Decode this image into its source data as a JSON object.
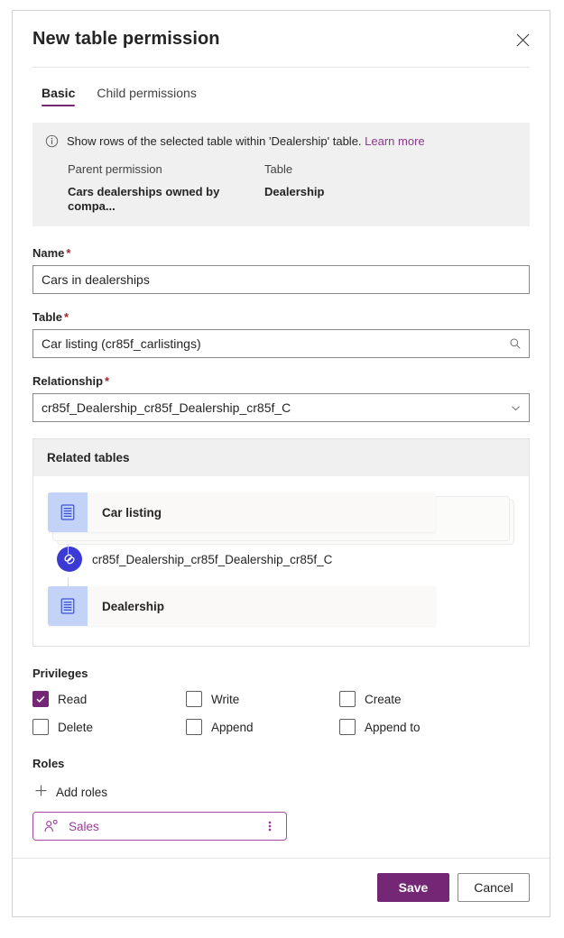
{
  "dialog": {
    "title": "New table permission",
    "close_icon": "close-icon"
  },
  "tabs": [
    {
      "label": "Basic",
      "active": true
    },
    {
      "label": "Child permissions",
      "active": false
    }
  ],
  "info_banner": {
    "icon": "info-icon",
    "message": "Show rows of the selected table within 'Dealership' table.",
    "learn_more": "Learn more",
    "columns": [
      {
        "header": "Parent permission",
        "value": "Cars dealerships owned by compa..."
      },
      {
        "header": "Table",
        "value": "Dealership"
      }
    ]
  },
  "fields": {
    "name": {
      "label": "Name",
      "required_marker": "*",
      "value": "Cars in dealerships",
      "placeholder": ""
    },
    "table": {
      "label": "Table",
      "required_marker": "*",
      "value": "Car listing (cr85f_carlistings)",
      "placeholder": "",
      "affix_icon": "search-icon"
    },
    "relationship": {
      "label": "Relationship",
      "required_marker": "*",
      "value": "cr85f_Dealership_cr85f_Dealership_cr85f_C",
      "placeholder": "",
      "affix_icon": "chevron-down-icon"
    }
  },
  "related_tables": {
    "header": "Related tables",
    "source_entity": "Car listing",
    "relationship_name": "cr85f_Dealership_cr85f_Dealership_cr85f_C",
    "target_entity": "Dealership",
    "entity_icon": "table-icon",
    "relationship_icon": "link-icon"
  },
  "privileges": {
    "label": "Privileges",
    "items": [
      {
        "label": "Read",
        "checked": true
      },
      {
        "label": "Write",
        "checked": false
      },
      {
        "label": "Create",
        "checked": false
      },
      {
        "label": "Delete",
        "checked": false
      },
      {
        "label": "Append",
        "checked": false
      },
      {
        "label": "Append to",
        "checked": false
      }
    ]
  },
  "roles": {
    "label": "Roles",
    "add_label": "Add roles",
    "add_icon": "plus-icon",
    "chips": [
      {
        "name": "Sales",
        "icon": "person-role-icon",
        "more_icon": "more-vertical-icon"
      }
    ]
  },
  "footer": {
    "save_label": "Save",
    "cancel_label": "Cancel"
  },
  "colors": {
    "accent": "#742774",
    "link": "#8a3a8a",
    "required": "#a4262c",
    "entity_badge": "#c3d3f7",
    "relationship_node": "#3b3bd4",
    "banner_bg": "#f0f0f0"
  }
}
